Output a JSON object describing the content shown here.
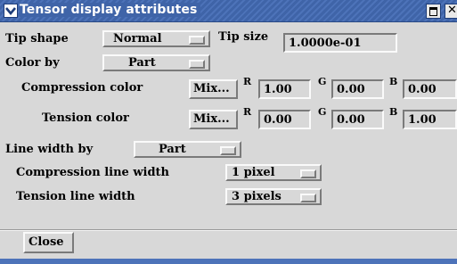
{
  "window": {
    "title": "Tensor display attributes"
  },
  "tip": {
    "shape_label": "Tip shape",
    "shape_value": "Normal",
    "size_label": "Tip size",
    "size_value": "1.0000e-01"
  },
  "color_by": {
    "label": "Color by",
    "value": "Part"
  },
  "compression_color": {
    "label": "Compression color",
    "button": "Mix...",
    "r_label": "R",
    "r_value": "1.00",
    "g_label": "G",
    "g_value": "0.00",
    "b_label": "B",
    "b_value": "0.00"
  },
  "tension_color": {
    "label": "Tension color",
    "button": "Mix...",
    "r_label": "R",
    "r_value": "0.00",
    "g_label": "G",
    "g_value": "0.00",
    "b_label": "B",
    "b_value": "1.00"
  },
  "line_width_by": {
    "label": "Line width by",
    "value": "Part"
  },
  "compression_line_width": {
    "label": "Compression line width",
    "value": "1 pixel"
  },
  "tension_line_width": {
    "label": "Tension line width",
    "value": "3 pixels"
  },
  "footer": {
    "close_label": "Close"
  },
  "colors": {
    "titlebar": "#3f64a8",
    "background": "#d8d8d8"
  }
}
